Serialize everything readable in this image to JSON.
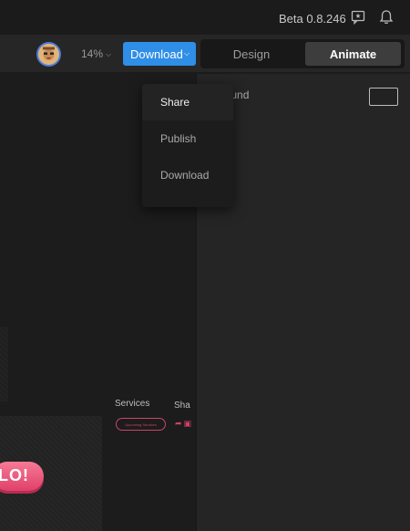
{
  "system_bar": {
    "version": "Beta 0.8.246",
    "icons": [
      "feedback-icon",
      "bell-icon"
    ]
  },
  "toolbar": {
    "zoom": "14%",
    "download_label": "Download",
    "modes": [
      {
        "label": "Design",
        "active": false
      },
      {
        "label": "Animate",
        "active": true
      }
    ],
    "accent_color": "#2f8ee6"
  },
  "canvas": {
    "hello_text": "LO!",
    "services_label": "Services",
    "services_pill": "Upcoming Services",
    "share_label": "Sha"
  },
  "panel": {
    "background_label": "kground"
  },
  "download_menu": {
    "items": [
      {
        "label": "Share",
        "active": true
      },
      {
        "label": "Publish",
        "active": false
      },
      {
        "label": "Download",
        "active": false
      }
    ]
  }
}
